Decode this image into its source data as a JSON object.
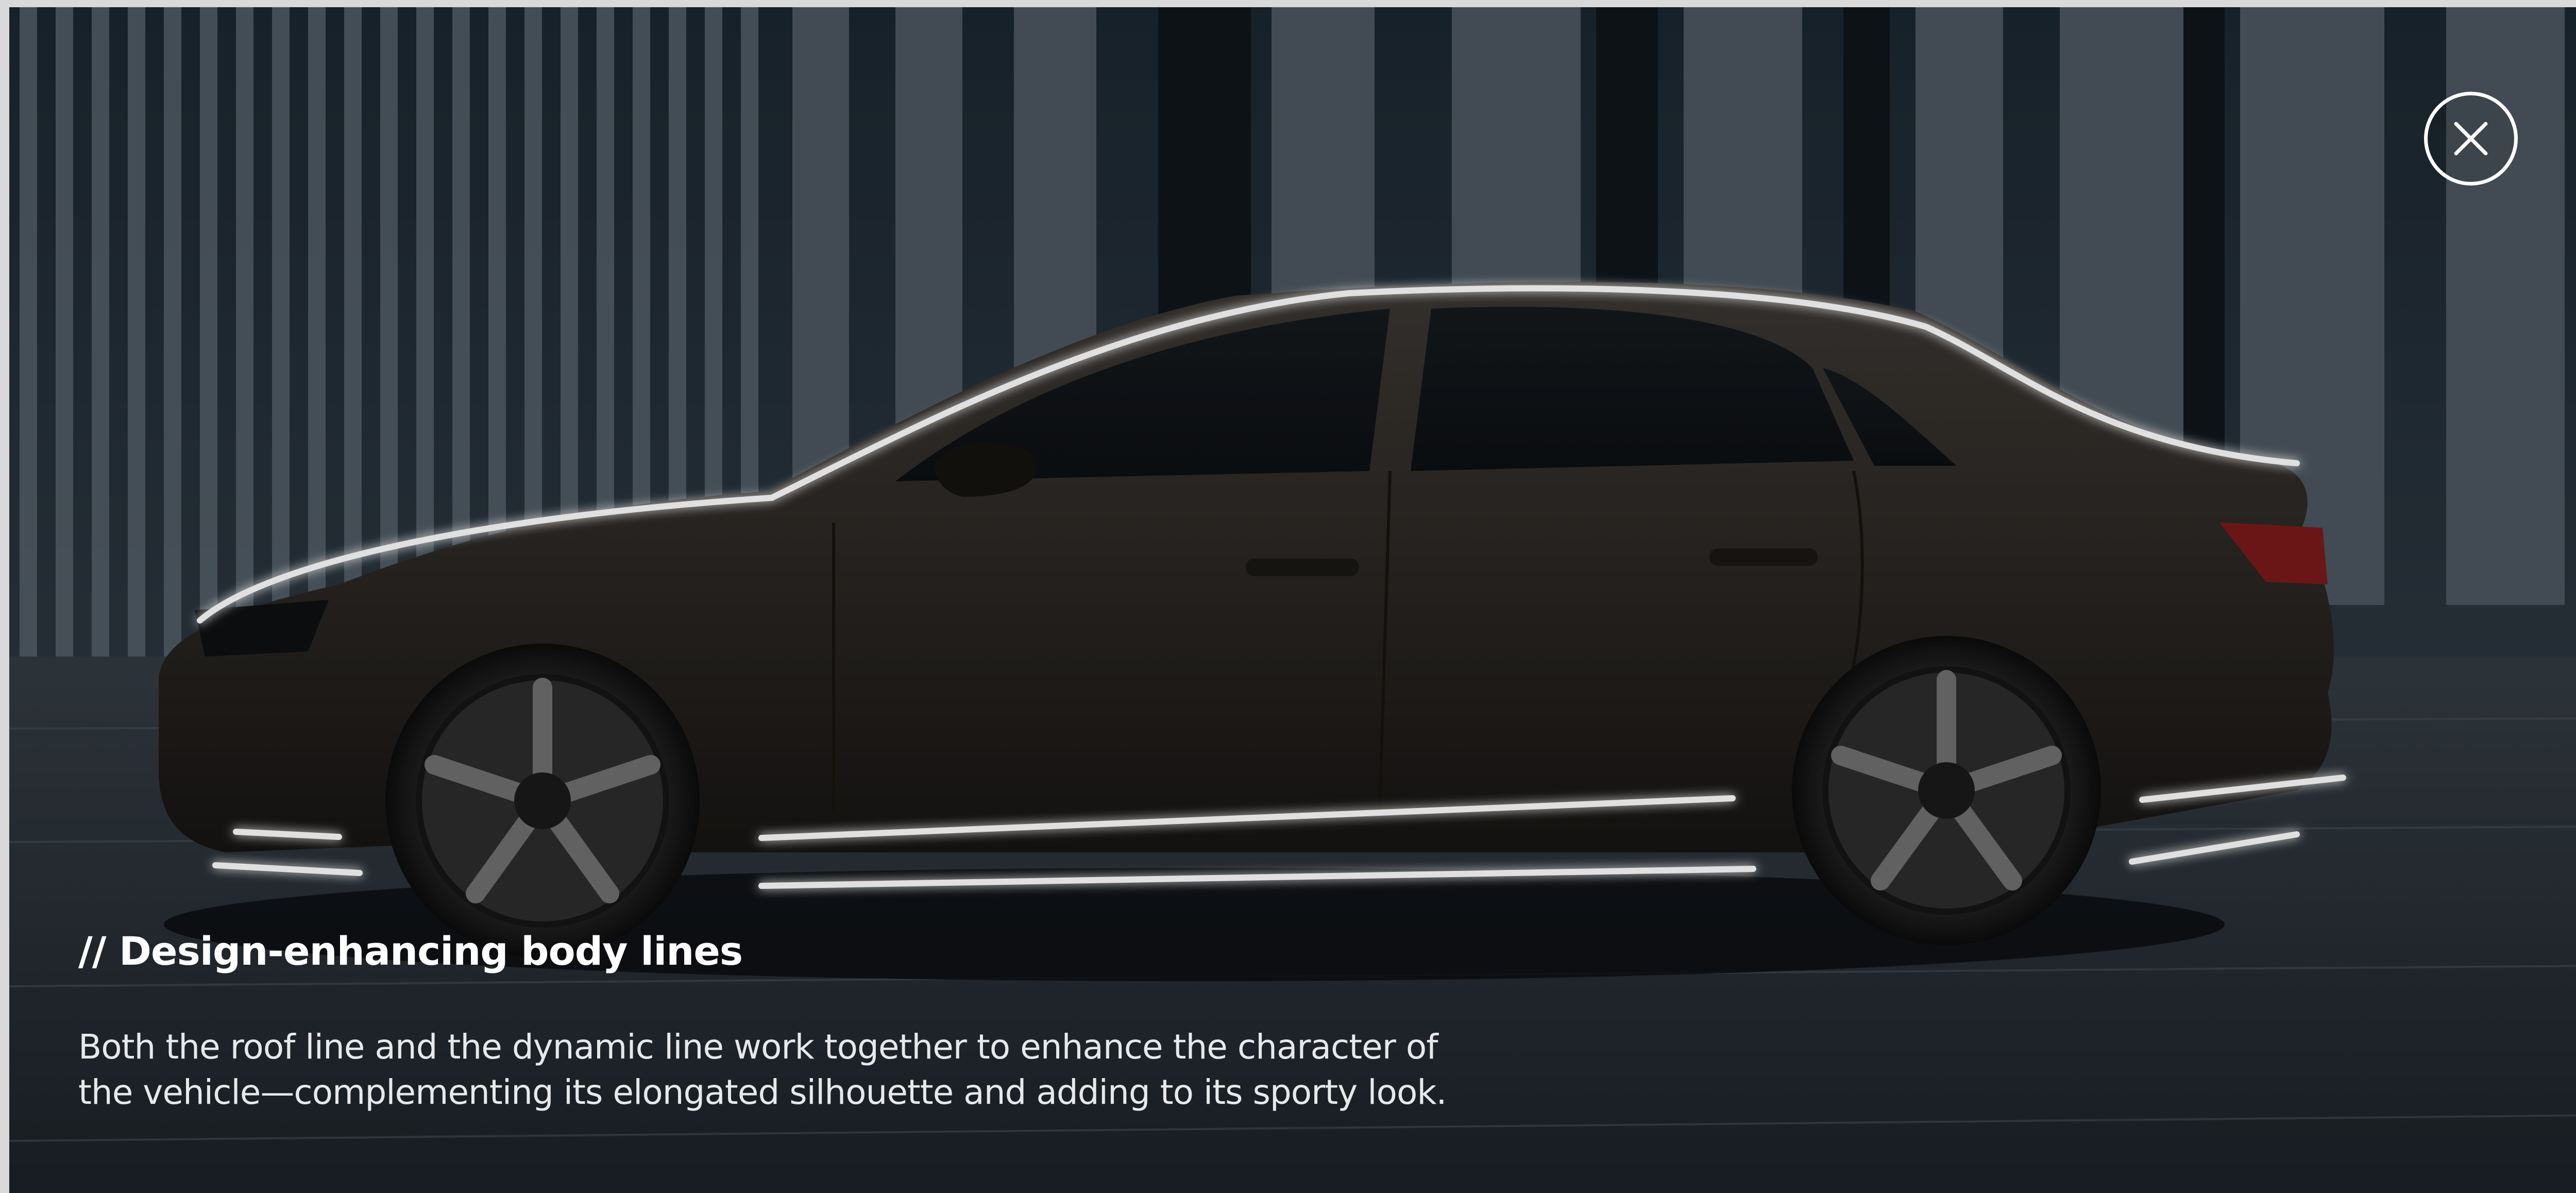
{
  "overlay": {
    "close_icon": "close-icon",
    "colors": {
      "accent_line": "#ffffff",
      "background": "#1f262d",
      "car_body": "#26221f"
    }
  },
  "caption": {
    "title": "// Design-enhancing body lines",
    "body_line_1": "Both the roof line and the dynamic line work together to enhance the character of",
    "body_line_2": "the vehicle—complementing its elongated silhouette and adding to its sporty look."
  }
}
